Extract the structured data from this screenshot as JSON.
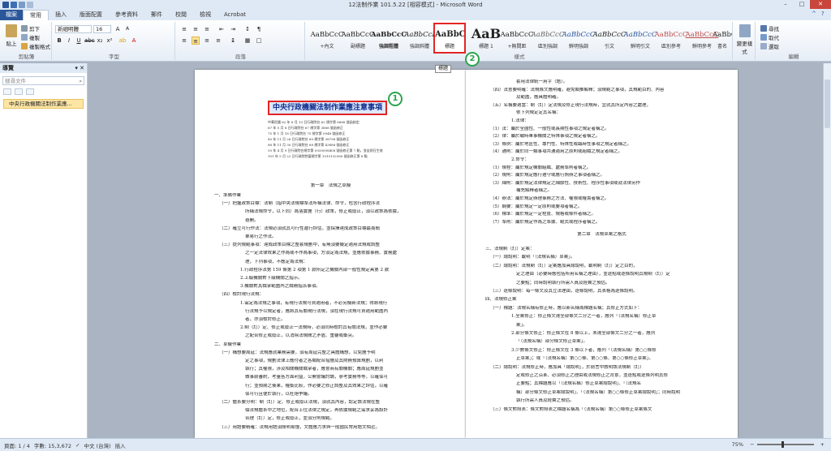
{
  "window": {
    "title": "12法制作業 101.5.22 [相容模式] - Microsoft Word",
    "controls": [
      "–",
      "□",
      "✕"
    ]
  },
  "tabs": [
    {
      "label": "檔案"
    },
    {
      "label": "常用"
    },
    {
      "label": "插入"
    },
    {
      "label": "版面配置"
    },
    {
      "label": "參考資料"
    },
    {
      "label": "郵件"
    },
    {
      "label": "校閱"
    },
    {
      "label": "檢視"
    },
    {
      "label": "Acrobat"
    }
  ],
  "ribbon": {
    "clipboard": {
      "label": "剪貼簿",
      "paste": "貼上",
      "cut": "剪下",
      "copy": "複製",
      "format_painter": "複製格式"
    },
    "font": {
      "label": "字型",
      "font_name": "新細明體",
      "font_size": "16"
    },
    "paragraph": {
      "label": "段落"
    },
    "styles": {
      "label": "樣式",
      "items": [
        {
          "preview": "AaBbCcC",
          "name": "+內文"
        },
        {
          "preview": "AaBbCcC",
          "name": "副標題"
        },
        {
          "preview": "AaBbCcC",
          "name": "強調粗體"
        },
        {
          "preview": "AaBbCcI",
          "name": "強調斜體"
        },
        {
          "preview": "AaBbC",
          "name": "標題"
        },
        {
          "preview": "AaB",
          "name": "標題 1"
        },
        {
          "preview": "AaBbCcC",
          "name": "+無間距"
        },
        {
          "preview": "AaBbCcC",
          "name": "區別強調"
        },
        {
          "preview": "AaBbCcC",
          "name": "鮮明強調"
        },
        {
          "preview": "AaBbCcC",
          "name": "引文"
        },
        {
          "preview": "AaBbCcC",
          "name": "鮮明引文"
        },
        {
          "preview": "AaBbCcC",
          "name": "區別參考"
        },
        {
          "preview": "AaBbCcC",
          "name": "鮮明參考"
        },
        {
          "preview": "AaBbCcC",
          "name": "書名"
        }
      ],
      "change_styles": "變更樣式"
    },
    "editing": {
      "label": "編輯",
      "find": "尋找",
      "replace": "取代",
      "select": "選取"
    }
  },
  "nav_pane": {
    "title": "導覽",
    "search_placeholder": "搜尋文件",
    "heading": "中央行政機關法制作業應..."
  },
  "tooltip": "標題",
  "badges": [
    "1",
    "2"
  ],
  "page1": {
    "title": "中央行政機關法制作業應注意事項",
    "notes": [
      "中華民國 62 年 8 月 13 日行政院台 62 規字第 6868 號函核定",
      "67 年 5 月 8 日行政院台 67 規字第 3888 號函修正",
      "75 年 1 月 18 日行政院台 75 規字第 0948 號函修正",
      "80 年 11 月 26 日行政院台 80 規字第 38798 號函修正",
      "88 年 11 月 30 日行政院台 88 規字第 43888 號函修正",
      "93 年 4 月 9 日行政院台規字第 0930098408 號函修正第 7 點，並自即日生效",
      "101 年 5 月 22 日行政院院臺規字第 1010132580 號函修正第 8 點"
    ],
    "chapter": "第一章　法規之草擬",
    "lines": [
      "一、準備作業",
      "（一）把握政策目標：法制（指中央法規標準法所稱法律、命令，包含行政程序法",
      "所稱法規命令，以下同）為落實施（行）政策，修正或廢止，須以政策為依據，",
      "避開。",
      "（二）確立可行作法：法規必須就其可行性進行評估，並採擇達成政策目標最為簡",
      "單易行之作法。",
      "（三）提列規範事項：達成政策目標之整套規劃中，有無須要擬定適用法規或調整",
      "之一定法律效果之作為或不作為事項，方須定為法規，並應依據事務、實務處",
      "理，下列事項，不應定為法規：",
      "1.行政程序法第 159 條第 2 項第 1 款所定之機關內部一般性規定具第 2 款",
      "2.上級機關對下級機關之指示。",
      "3.機關對其職掌範圍內之職務指派事項。",
      "（四）檢討現行法規：",
      "1.需定為法規之事項，有現行法規可資適用者，不必另擬新法規；得將現行",
      "行法規予以規定者，應將其有關現行法規，須在現行法規可資適用範圍內",
      "者，亦須檢討修正。",
      "2.制（訂）定、修正或廢止一法規時，必須同時檢討其有關法規，並作必要",
      "之配合修正或廢止，以消除法規間之矛盾、重疊或衝突。",
      "二、草擬作業",
      "（一）構想要周延：法規應就業務需要，須有周延完整之具體構想，以免施予明",
      "定之事項，規劃法律上應付者之各類配合措施及其財務預算規劃，以利",
      "執行；其權限，涉及相關機關職掌者，應會商有關機關；應周延規劃並",
      "做事前審酌，考量各方面利益，公開會議討論，參考實務等等，以確保可",
      "行；並預期之後果，權衡比較，作必要之修正調整及其效果之評估，以確",
      "保可行且便於執行，以杜絕爭議。",
      "（二）體系要分明：制（訂）定、修正或廢止法規，須就其內容，認定該法規在整",
      "個法規體系中之地位，配合上位法律之規定，再依據規範之需求妥為設計",
      "合理（訂）定，修正或廢止，並須分則規範。",
      "（三）用語要精確：法規用語須簡明易懂，文體應力求與一般國民常用語文相近。"
    ]
  },
  "page2": {
    "lines": [
      "套用法律統一用字（語）。",
      "（四）法意要明確：法規條文應明確，避免類推解釋；須規範之事項，其規範目的、內容",
      "及範圍，應具體明確。",
      "（五）名稱要適當：制（訂）定法規及修正現行法規時，宜就其所定內容之處理，",
      "依下列規定定其名稱：",
      "1.法律：",
      "（1）法：屬於全國性、一般性或長期性事項之規定者稱之。",
      "（2）律：屬於戰時軍事機關之特殊事項之規定者稱之。",
      "（3）條例：屬於地區性、專門性、特殊性或臨時性事項之規定者稱之。",
      "（4）通則：屬於同一類事項共通適用之原則或組織之規定者稱之。",
      "2.命令：",
      "（1）規程：屬於規定機關組織、處務準則者稱之。",
      "（2）規則：屬於規定應行遵守或應行照辦之事項者稱之。",
      "（3）細則：屬於規定法律規定之細節性、技術性、程序性事項或就法律另作",
      "補充解釋者稱之。",
      "（4）辦法：屬於規定辦理事務之方法、權限或權責者稱之。",
      "（5）綱要：屬於規定一定原則或要項者稱之。",
      "（6）標準：屬於規定一定程度、規格或條件者稱之。",
      "（7）準則：屬於規定作為之準據、範式或程序者稱之。"
    ],
    "chapter": "第二章　法規草案之格式",
    "lines2": [
      "三、法規制（訂）定案：",
      "（一）總說明：載明「（法規名稱）草案」。",
      "（二）總說明：法規制（訂）定案應加具總說明，載明制（訂）定之目的，",
      "定之理由（必要時應包括所用名稱之理由），並逐點或逐條說明其規制（訂）定",
      "之要點；同時說明執行所需人員及經費之預估。",
      "（三）逐條說明：每一條文及其立法理由，逐條說明，其表格為逐條說明。",
      "四、法規修正案",
      "（一）標題：法規名稱有修正時，應以新名稱為標題名稱；其修正方式如下：",
      "1.全案修正：修正條文達全部條文二分之一者，應列「（法規名稱）修正草",
      "案」。",
      "2.部分條文修正：修正條文在 8 條以上，未達全部條文二分之一者，應列",
      "「（法規名稱）部分條文修正草案」。",
      "3.少數條文修正：修正條文在 3 條以下者，應列「（法規名稱）第○○條修",
      "正草案」；或「（法規名稱）第○○條、第○○條、第○○條修正草案」。",
      "（二）總說明：法規修正時，應加具「總說明」，於前言中敘明該法規制（訂）",
      "定或修正之沿革、必須修正之理由或法規修正之背景，並逐點或逐條列明其修",
      "正要點；其標題應以「（法規名稱）修正草案總說明」、「（法規名",
      "稱）部分條文修正草案總說明」、「（法規名稱）第○○條修正草案總說明」；同時說明",
      "執行所需人員及經費之預估。",
      "（三）條文對照表：條文對照表之標題名稱為「（法規名稱）第○○條修正草案條文"
    ]
  },
  "status": {
    "page": "頁面: 1 / 4",
    "words": "字數: 15,3,672",
    "language": "中文 (台灣)",
    "mode": "插入",
    "zoom": "75%"
  },
  "colors": {
    "highlight_red": "#e32525",
    "badge_green": "#2da44e",
    "nav_highlight": "#fde6a5",
    "file_tab": "#2b579a"
  }
}
